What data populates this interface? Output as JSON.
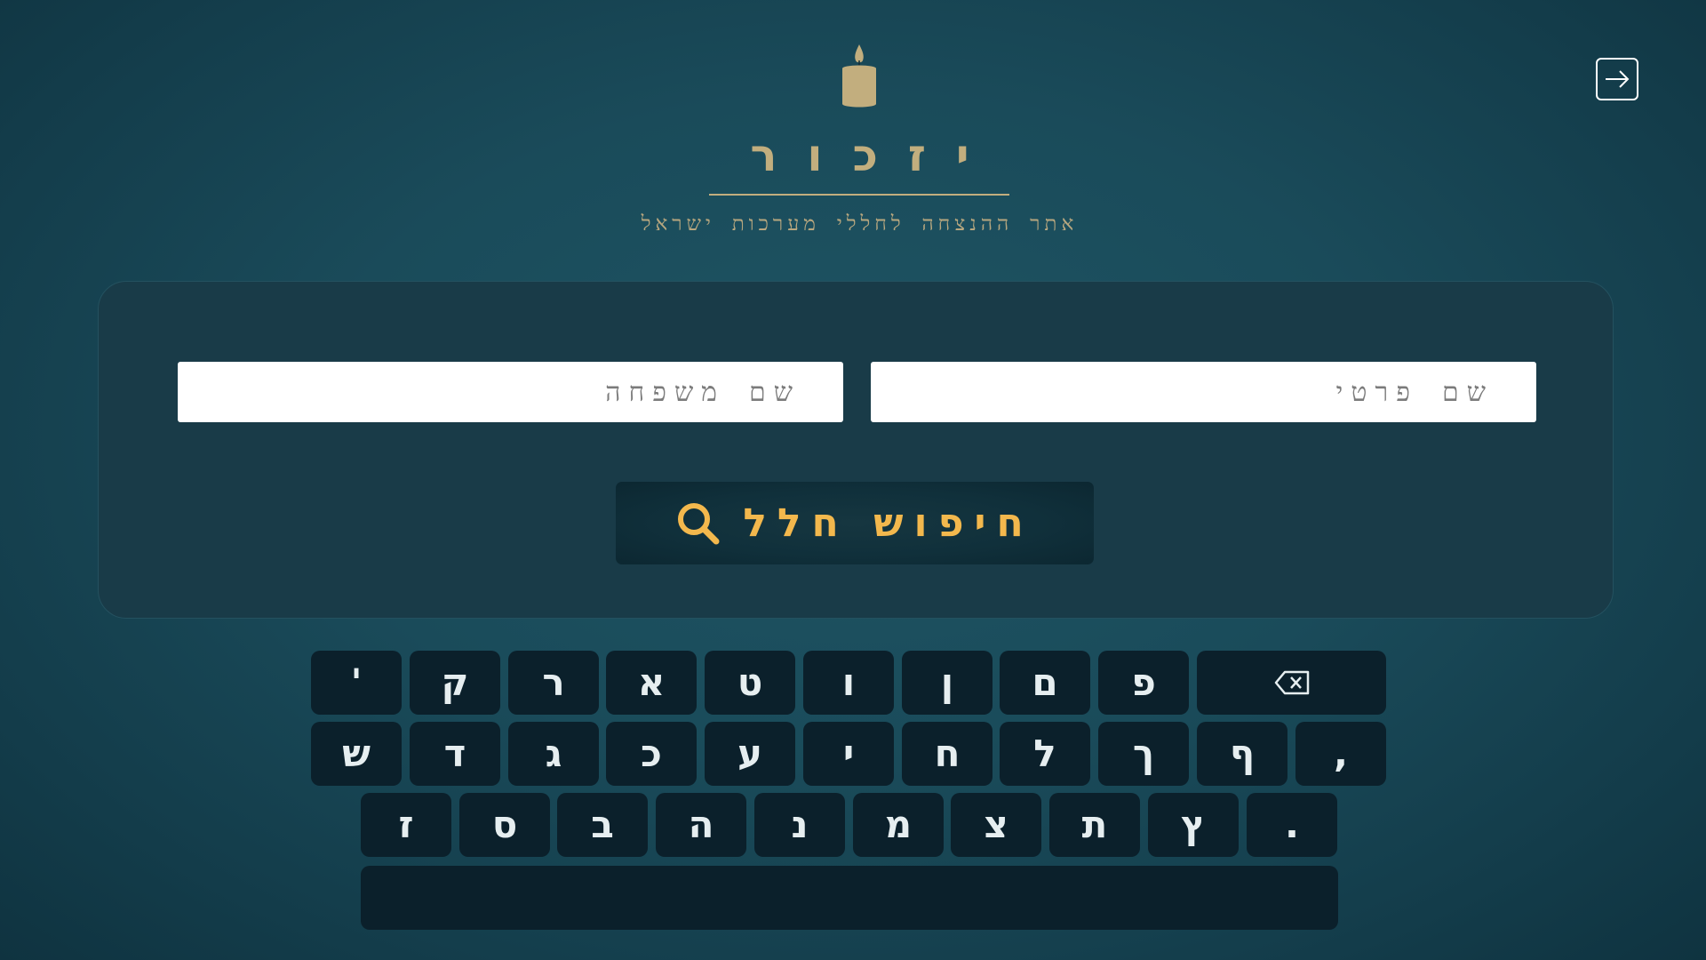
{
  "header": {
    "title": "יזכור",
    "subtitle": "אתר ההנצחה לחללי מערכות ישראל"
  },
  "exit_button": {
    "icon": "arrow-right-icon"
  },
  "search": {
    "first_name_placeholder": "שם פרטי",
    "last_name_placeholder": "שם משפחה",
    "first_name_value": "",
    "last_name_value": "",
    "button_label": "חיפוש חלל",
    "button_icon": "search-icon"
  },
  "keyboard": {
    "row1": [
      "'",
      "ק",
      "ר",
      "א",
      "ט",
      "ו",
      "ן",
      "ם",
      "פ"
    ],
    "row2": [
      "ש",
      "ד",
      "ג",
      "כ",
      "ע",
      "י",
      "ח",
      "ל",
      "ך",
      "ף",
      ","
    ],
    "row3": [
      "ז",
      "ס",
      "ב",
      "ה",
      "נ",
      "מ",
      "צ",
      "ת",
      "ץ",
      "."
    ],
    "backspace_icon": "backspace-icon",
    "space_label": ""
  },
  "colors": {
    "background": "#1a4b5a",
    "panel": "#193b48",
    "gold": "#c2ae7e",
    "accent": "#f3b84d",
    "key": "#0b202b"
  }
}
